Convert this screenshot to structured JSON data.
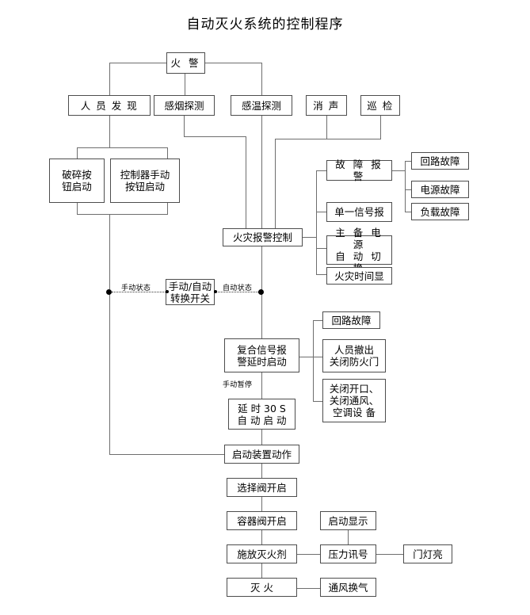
{
  "title": "自动灭火系统的控制程序",
  "diagram": {
    "type": "flowchart",
    "nodes": {
      "fire_alarm": "火 警",
      "person_detect": "人 员 发 现",
      "smoke_detect": "感烟探测",
      "heat_detect": "感温探测",
      "silence": "消 声",
      "patrol": "巡 检",
      "break_button": "破碎按\n钮启动",
      "controller_button": "控制器手动\n按钮启动",
      "fire_alarm_control": "火灾报警控制",
      "fault_alarm": "故 障 报 警",
      "single_signal": "单一信号报",
      "power_switch": "主 备 电 源\n自 动 切 换",
      "fire_time_display": "火灾时间显",
      "loop_fault_1": "回路故障",
      "power_fault": "电源故障",
      "load_fault": "负载故障",
      "manual_auto_switch": "手动/自动\n转换开关",
      "composite_signal": "复合信号报\n警延时启动",
      "loop_fault_2": "回路故障",
      "evacuate": "人员撤出\n关闭防火门",
      "close_openings": "关闭开口、\n关闭通风、\n空调设 备",
      "delay_30s": "延 时 30 S\n自 动 启 动",
      "start_device": "启动装置动作",
      "select_valve": "选择阀开启",
      "container_valve": "容器阀开启",
      "release_agent": "施放灭火剂",
      "start_display": "启动显示",
      "pressure_signal": "压力讯号",
      "door_light": "门灯亮",
      "extinguish": "灭  火",
      "ventilation": "通风换气"
    },
    "edge_labels": {
      "manual_state": "手动状态",
      "auto_state": "自动状态",
      "manual_pause": "手动暂停"
    },
    "colors": {
      "box_border": "#4d4d4d",
      "line": "#6e6e6e",
      "text": "#000000",
      "background": "#ffffff"
    }
  }
}
